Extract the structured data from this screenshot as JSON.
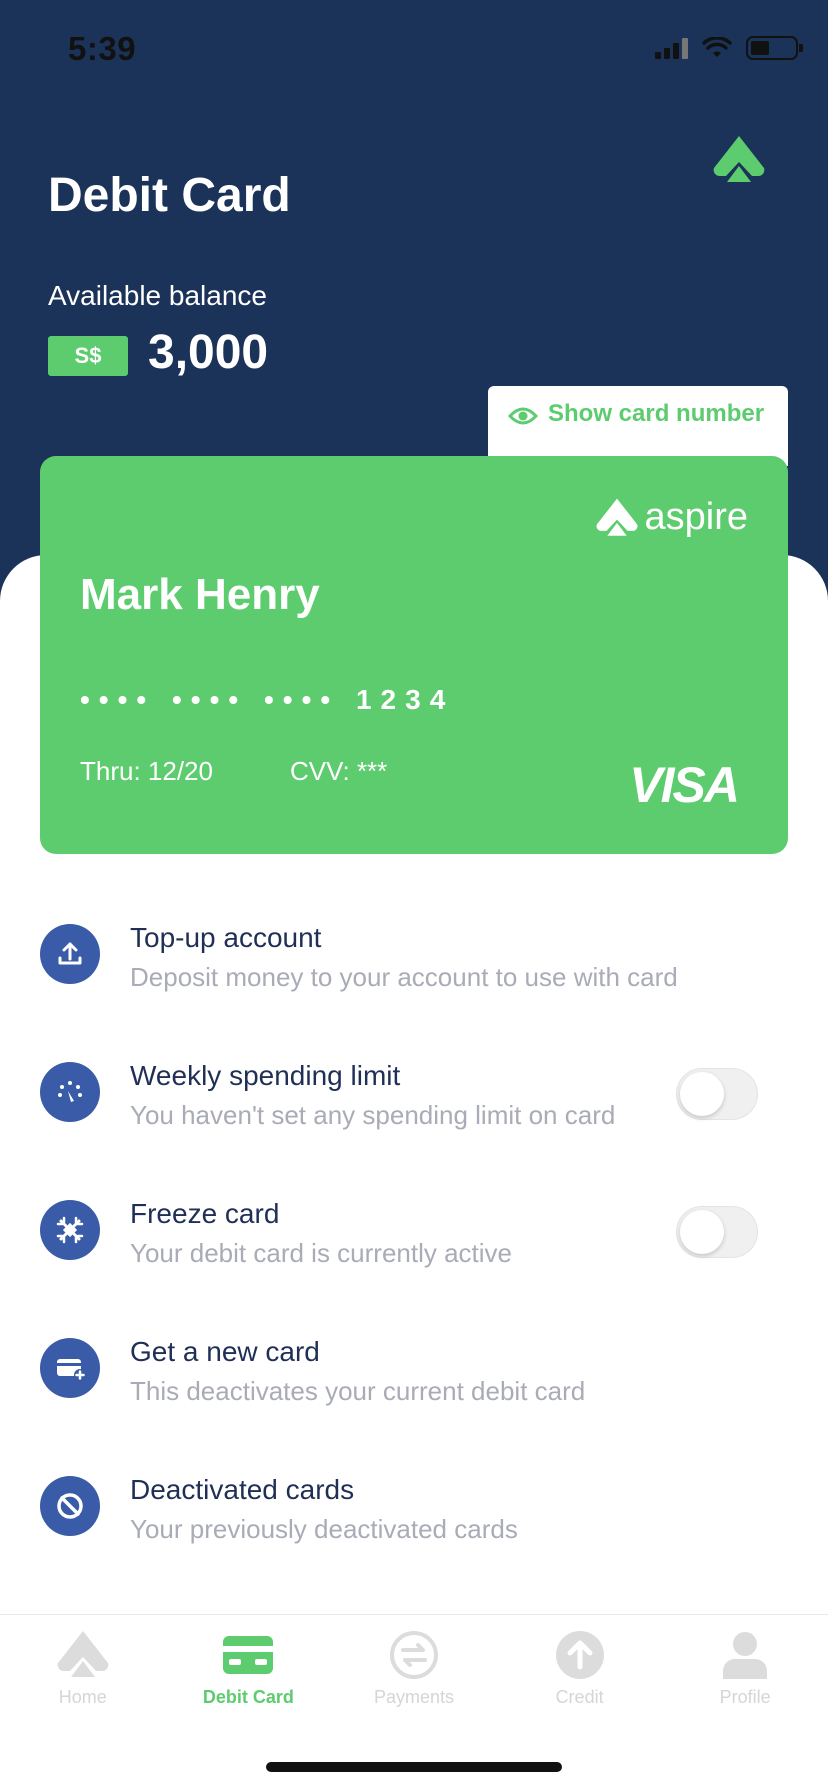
{
  "status_bar": {
    "time": "5:39"
  },
  "header": {
    "title": "Debit Card",
    "balance_label": "Available balance",
    "currency": "S$",
    "balance": "3,000",
    "show_card_label": "Show card number"
  },
  "card": {
    "brand": "aspire",
    "holder": "Mark Henry",
    "number": "•••• •••• •••• 1234",
    "thru": "Thru: 12/20",
    "cvv": "CVV: ***",
    "network": "VISA"
  },
  "menu": [
    {
      "title": "Top-up account",
      "subtitle": "Deposit money to your account to use with card",
      "icon": "upload-icon"
    },
    {
      "title": "Weekly spending limit",
      "subtitle": "You haven't set any spending limit on card",
      "icon": "speedometer-icon",
      "toggle": false
    },
    {
      "title": "Freeze card",
      "subtitle": "Your debit card is currently active",
      "icon": "snowflake-icon",
      "toggle": false
    },
    {
      "title": "Get a new card",
      "subtitle": "This deactivates your current debit card",
      "icon": "new-card-icon"
    },
    {
      "title": "Deactivated cards",
      "subtitle": "Your previously deactivated cards",
      "icon": "ban-icon"
    }
  ],
  "tabbar": [
    {
      "label": "Home",
      "icon": "aspire-logo-icon",
      "active": false
    },
    {
      "label": "Debit Card",
      "icon": "card-icon",
      "active": true
    },
    {
      "label": "Payments",
      "icon": "transfer-icon",
      "active": false
    },
    {
      "label": "Credit",
      "icon": "arrow-up-icon",
      "active": false
    },
    {
      "label": "Profile",
      "icon": "person-icon",
      "active": false
    }
  ],
  "colors": {
    "navy": "#1b3359",
    "green": "#5ccc6e",
    "icon_blue": "#3a5ba8"
  }
}
